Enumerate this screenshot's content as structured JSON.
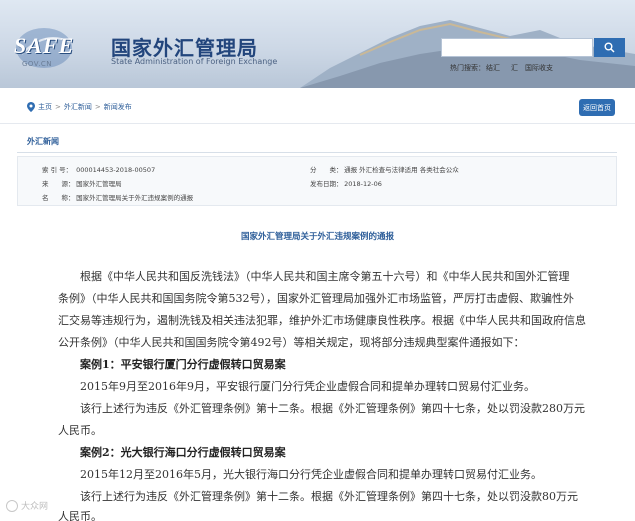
{
  "header": {
    "logo_text": "SAFE",
    "logo_sub": "GOV.CN",
    "site_title_cn": "国家外汇管理局",
    "site_title_en": "State Administration of Foreign Exchange",
    "search_placeholder": "",
    "hot_label": "热门搜索：",
    "hot_items": [
      "结汇",
      "汇",
      "国际收支"
    ]
  },
  "breadcrumb": {
    "items": [
      "主页",
      "外汇新闻",
      "新闻发布"
    ],
    "separator": ">"
  },
  "return_button": "返回首页",
  "section_title": "外汇新闻",
  "meta": {
    "index_key": "索 引 号：",
    "index_val": "000014453-2018-00507",
    "source_key": "来　　源：",
    "source_val": "国家外汇管理局",
    "name_key": "名　　称：",
    "name_val": "国家外汇管理局关于外汇违规案例的通报",
    "category_key": "分　　类：",
    "category_val": "通报  外汇检查与法律适用  各类社会公众",
    "date_key": "发布日期：",
    "date_val": "2018-12-06"
  },
  "article": {
    "title": "国家外汇管理局关于外汇违规案例的通报",
    "intro_lines": [
      "根据《中华人民共和国反洗钱法》（中华人民共和国主席令第五十六号）和《中华人民共和国外汇管理",
      "条例》（中华人民共和国国务院令第532号），国家外汇管理局加强外汇市场监管，严厉打击虚假、欺骗性外",
      "汇交易等违规行为，遏制洗钱及相关违法犯罪，维护外汇市场健康良性秩序。根据《中华人民共和国政府信息",
      "公开条例》（中华人民共和国国务院令第492号）等相关规定，现将部分违规典型案件通报如下："
    ],
    "case1_title": "案例1：平安银行厦门分行虚假转口贸易案",
    "case1_line1": "2015年9月至2016年9月，平安银行厦门分行凭企业虚假合同和提单办理转口贸易付汇业务。",
    "case1_line2": "该行上述行为违反《外汇管理条例》第十二条。根据《外汇管理条例》第四十七条，处以罚没款280万元",
    "case1_line3": "人民币。",
    "case2_title": "案例2：光大银行海口分行虚假转口贸易案",
    "case2_line1": "2015年12月至2016年5月，光大银行海口分行凭企业虚假合同和提单办理转口贸易付汇业务。",
    "case2_line2": "该行上述行为违反《外汇管理条例》第十二条。根据《外汇管理条例》第四十七条，处以罚没款80万元",
    "case2_line3": "人民币。"
  },
  "watermark": "大众网",
  "colors": {
    "brand_blue": "#2f6db2",
    "title_blue": "#22457c",
    "link_blue": "#2f5f9a"
  }
}
